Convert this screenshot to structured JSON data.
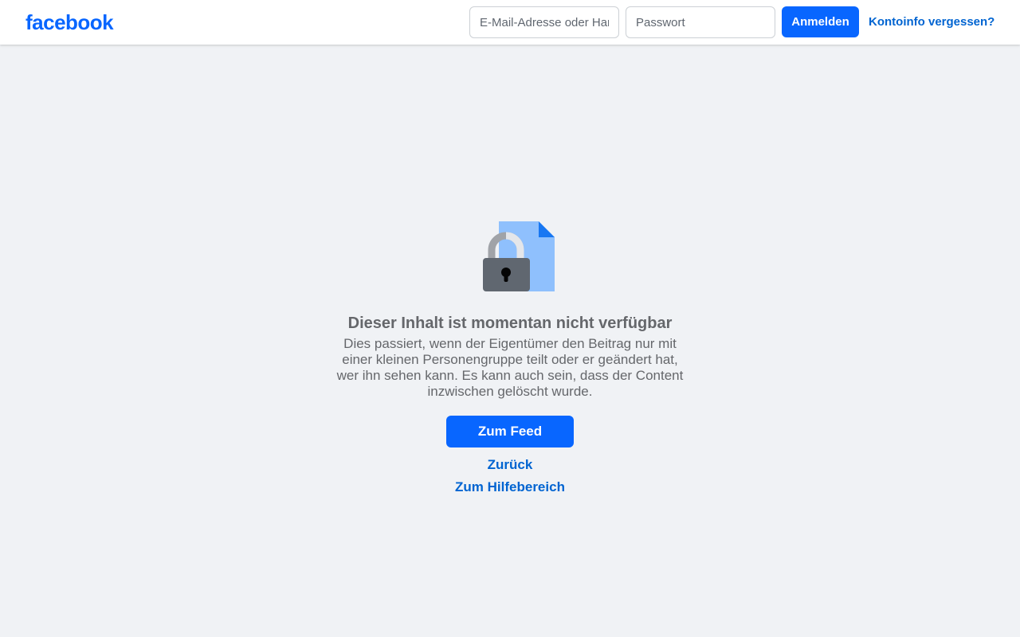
{
  "header": {
    "logo_text": "facebook",
    "email_placeholder": "E-Mail-Adresse oder Handynummer",
    "password_placeholder": "Passwort",
    "login_label": "Anmelden",
    "forgot_label": "Kontoinfo vergessen?"
  },
  "main": {
    "illustration_icon": "locked-document-icon",
    "title": "Dieser Inhalt ist momentan nicht verfügbar",
    "description": "Dies passiert, wenn der Eigentümer den Beitrag nur mit einer kleinen Personengruppe teilt oder er geändert hat, wer ihn sehen kann. Es kann auch sein, dass der Content inzwischen gelöscht wurde.",
    "feed_button_label": "Zum Feed",
    "back_link_label": "Zurück",
    "help_link_label": "Zum Hilfebereich"
  },
  "colors": {
    "brand_blue": "#0866ff",
    "link_blue": "#0064d1",
    "background": "#f0f2f5",
    "muted_text": "#65676b"
  }
}
